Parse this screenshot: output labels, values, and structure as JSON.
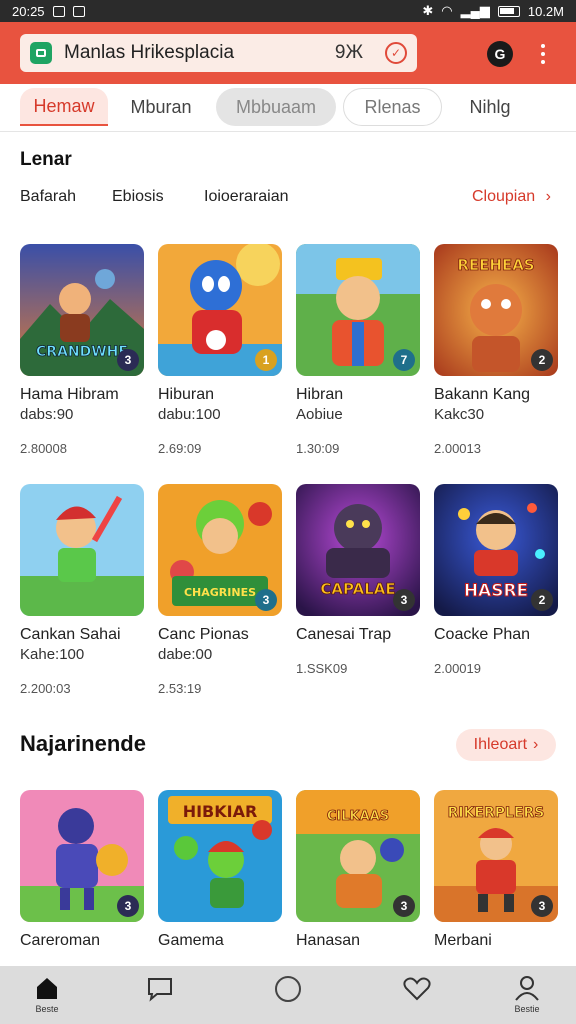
{
  "status": {
    "time": "20:25",
    "right_text": "10.2M"
  },
  "header": {
    "app_title": "Manlas Hrikesplacia",
    "counter": "9Ж"
  },
  "tabs": [
    {
      "label": "Hemaw"
    },
    {
      "label": "Mburan"
    },
    {
      "label": "Mbbuaam"
    },
    {
      "label": "Rlenas"
    },
    {
      "label": "Nihlg"
    }
  ],
  "section1": {
    "title": "Lenar",
    "filters": [
      "Bafarah",
      "Ebiosis",
      "Ioioeraraian"
    ],
    "see_more": "Cloupian"
  },
  "section2": {
    "title": "Najarinende",
    "see_more": "Ihleoart"
  },
  "row1": [
    {
      "title": "Hama Hibram",
      "sub": "dabs:90",
      "meta": "2.80008",
      "art": "CRANDWHE",
      "badge": "3"
    },
    {
      "title": "Hiburan",
      "sub": "dabu:100",
      "meta": "2.69:09",
      "art": "",
      "badge": "1"
    },
    {
      "title": "Hibran",
      "sub": "Aobiue",
      "meta": "1.30:09",
      "art": "",
      "badge": "7"
    },
    {
      "title": "Bakann Kang",
      "sub": "Kakc30",
      "meta": "2.00013",
      "art": "REEHEAS",
      "badge": "2"
    }
  ],
  "row2": [
    {
      "title": "Cankan Sahai",
      "sub": "Kahe:100",
      "meta": "2.200:03",
      "art": "",
      "badge": ""
    },
    {
      "title": "Canc Pionas",
      "sub": "dabe:00",
      "meta": "2.53:19",
      "art": "CHAGRINES",
      "badge": "3"
    },
    {
      "title": "Canesai Trap",
      "sub": "",
      "meta": "1.SSK09",
      "art": "CAPALAE",
      "badge": "3"
    },
    {
      "title": "Coacke Phan",
      "sub": "",
      "meta": "2.00019",
      "art": "HASRE",
      "badge": "2"
    }
  ],
  "row3": [
    {
      "title": "Careroman",
      "sub": "",
      "meta": "",
      "art": "",
      "badge": "3"
    },
    {
      "title": "Gamema",
      "sub": "",
      "meta": "",
      "art": "HIBKIAR",
      "badge": ""
    },
    {
      "title": "Hanasan",
      "sub": "",
      "meta": "",
      "art": "CILKAAS",
      "badge": "3"
    },
    {
      "title": "Merbani",
      "sub": "",
      "meta": "",
      "art": "RIKERPLERS",
      "badge": "3"
    }
  ],
  "bottom_nav": [
    {
      "label": "Beste",
      "icon": "home-icon"
    },
    {
      "label": "",
      "icon": "chat-icon"
    },
    {
      "label": "",
      "icon": "circle-icon"
    },
    {
      "label": "",
      "icon": "heart-icon"
    },
    {
      "label": "Bestie",
      "icon": "profile-icon"
    }
  ],
  "colors": {
    "accent": "#e8533f",
    "accent_text": "#d63a2b",
    "nav_bg": "#dcdcdc"
  }
}
